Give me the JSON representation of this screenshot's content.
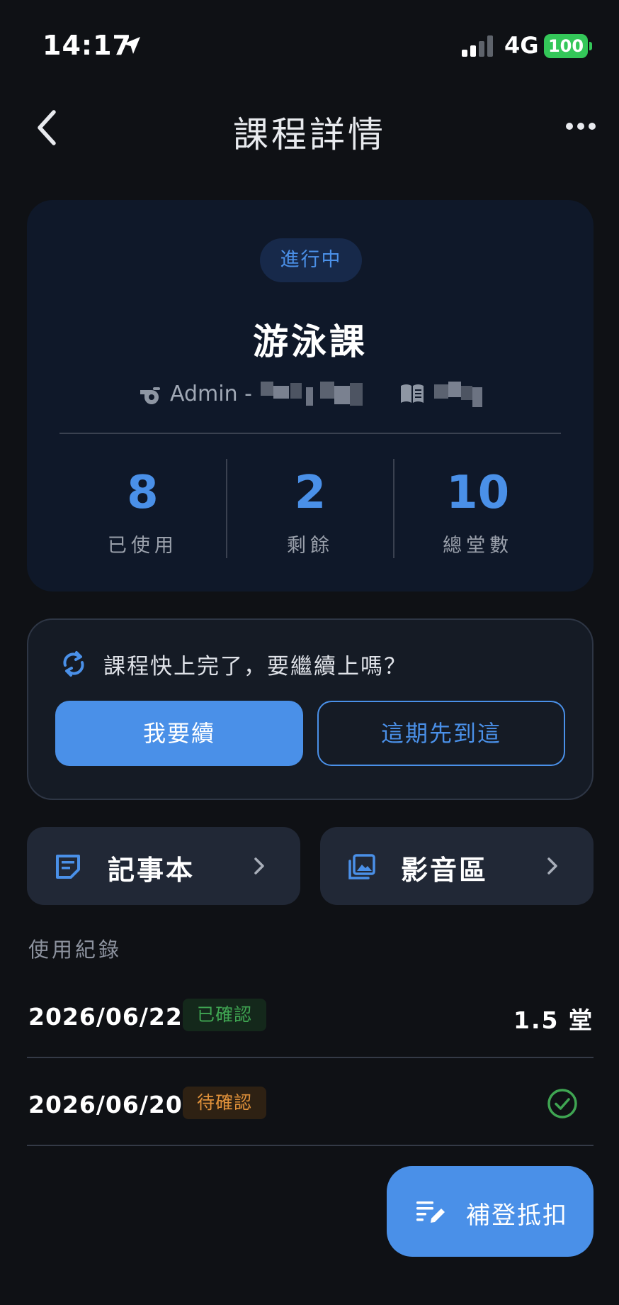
{
  "status_bar": {
    "time": "14:17",
    "network": "4G",
    "battery": "100",
    "icons": [
      "location-arrow-icon",
      "signal-icon",
      "battery-icon"
    ]
  },
  "nav": {
    "title": "課程詳情",
    "icons": [
      "chevron-left-icon",
      "more-icon"
    ]
  },
  "course": {
    "status": "進行中",
    "title": "游泳課",
    "coach_prefix": "Admin -",
    "icons": [
      "whistle-icon",
      "book-icon"
    ],
    "stats": [
      {
        "value": "8",
        "label": "已使用"
      },
      {
        "value": "2",
        "label": "剩餘"
      },
      {
        "value": "10",
        "label": "總堂數"
      }
    ]
  },
  "renew": {
    "prompt": "課程快上完了，要繼續上嗎？",
    "confirm_label": "我要續",
    "decline_label": "這期先到這",
    "icon": "refresh-icon"
  },
  "tiles": {
    "notes_label": "記事本",
    "media_label": "影音區",
    "icons": [
      "notes-icon",
      "photo-library-icon",
      "chevron-right-icon"
    ]
  },
  "records": {
    "section_label": "使用紀錄",
    "items": [
      {
        "date": "2026/06/22",
        "status": "已確認",
        "amount": "1.5 堂"
      },
      {
        "date": "2026/06/20",
        "status": "待確認",
        "amount": ""
      }
    ]
  },
  "fab": {
    "label": "補登抵扣",
    "icon": "edit-list-icon"
  },
  "colors": {
    "background": "#0f1115",
    "card": "#0f1829",
    "accent": "#4a90e8",
    "confirmed": "#3fa552",
    "pending": "#e0913a"
  }
}
